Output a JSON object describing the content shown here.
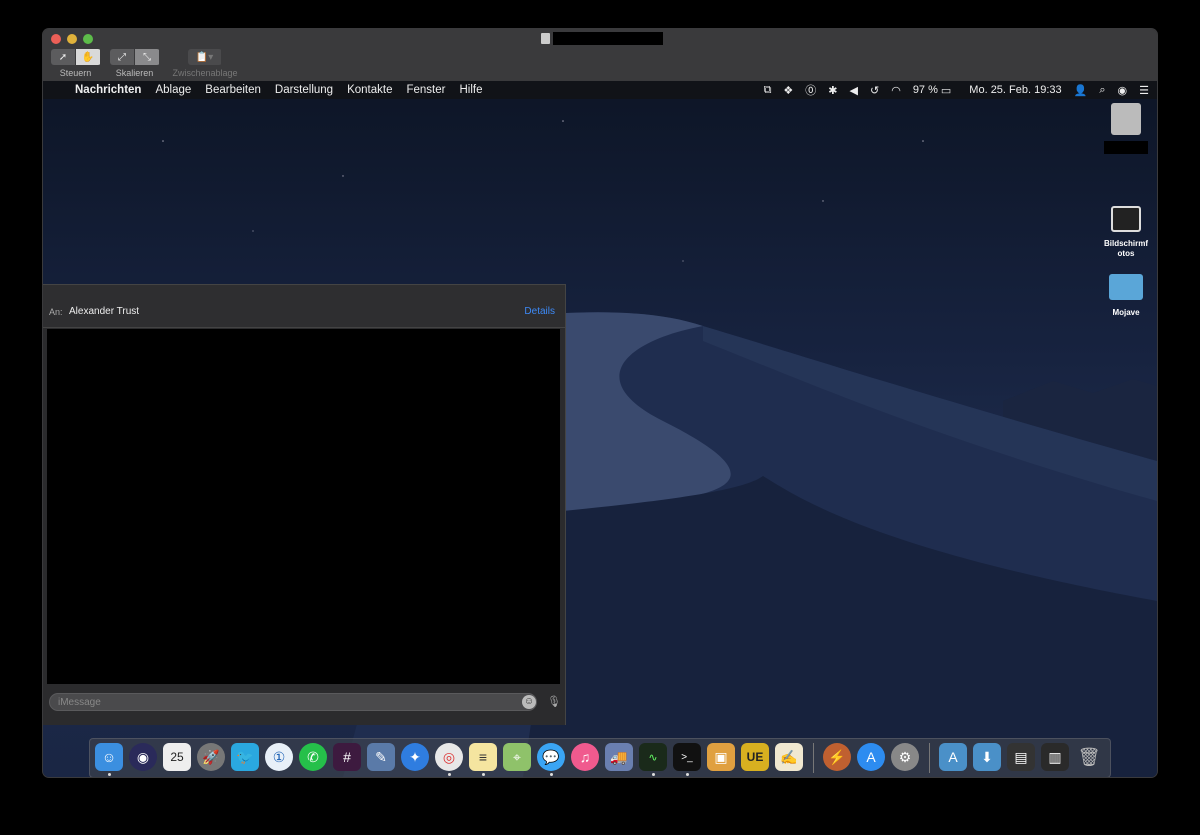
{
  "window": {
    "toolbar": {
      "steuern_label": "Steuern",
      "skalieren_label": "Skalieren",
      "zwischenablage_label": "Zwischenablage"
    }
  },
  "menubar": {
    "apple": "",
    "app_name": "Nachrichten",
    "menus": [
      "Ablage",
      "Bearbeiten",
      "Darstellung",
      "Kontakte",
      "Fenster",
      "Hilfe"
    ],
    "battery": "97 %",
    "datetime": "Mo. 25. Feb.  19:33"
  },
  "desktop": {
    "items": [
      {
        "label": ""
      },
      {
        "label": "Bildschirmf otos"
      },
      {
        "label": "Mojave"
      }
    ]
  },
  "messages": {
    "to_label": "An:",
    "recipient": "Alexander Trust",
    "details_label": "Details",
    "input_placeholder": "iMessage"
  },
  "dock": {
    "calendar_day": "25"
  },
  "colors": {
    "accent": "#3d8af7",
    "close": "#ec5f57",
    "minimize": "#e0b23b",
    "zoom": "#5dbc4a"
  }
}
